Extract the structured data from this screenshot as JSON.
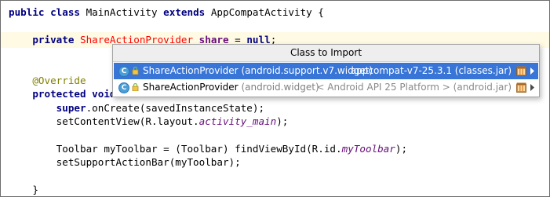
{
  "editor": {
    "lines": [
      {
        "parts": [
          {
            "t": "public class ",
            "c": "kw"
          },
          {
            "t": "MainActivity ",
            "c": ""
          },
          {
            "t": "extends ",
            "c": "kw"
          },
          {
            "t": "AppCompatActivity {",
            "c": ""
          }
        ]
      },
      {
        "parts": []
      },
      {
        "parts": [
          {
            "t": "    ",
            "c": ""
          },
          {
            "t": "private ",
            "c": "kw"
          },
          {
            "t": "ShareActionProvider",
            "c": "cls-err"
          },
          {
            "t": " ",
            "c": ""
          },
          {
            "t": "share",
            "c": "field"
          },
          {
            "t": " = ",
            "c": ""
          },
          {
            "t": "null",
            "c": "kw"
          },
          {
            "t": ";",
            "c": ""
          }
        ],
        "highlight": true
      },
      {
        "parts": []
      },
      {
        "parts": []
      },
      {
        "parts": [
          {
            "t": "    ",
            "c": ""
          },
          {
            "t": "@Override",
            "c": "ann"
          }
        ]
      },
      {
        "parts": [
          {
            "t": "    ",
            "c": ""
          },
          {
            "t": "protected void ",
            "c": "kw"
          },
          {
            "t": "o",
            "c": ""
          }
        ]
      },
      {
        "parts": [
          {
            "t": "        ",
            "c": ""
          },
          {
            "t": "super",
            "c": "kw"
          },
          {
            "t": ".onCreate(savedInstanceState);",
            "c": ""
          }
        ]
      },
      {
        "parts": [
          {
            "t": "        setContentView(R.layout.",
            "c": ""
          },
          {
            "t": "activity_main",
            "c": "field-it"
          },
          {
            "t": ");",
            "c": ""
          }
        ]
      },
      {
        "parts": []
      },
      {
        "parts": [
          {
            "t": "        Toolbar myToolbar = (Toolbar) findViewById(R.id.",
            "c": ""
          },
          {
            "t": "myToolbar",
            "c": "field-it"
          },
          {
            "t": ");",
            "c": ""
          }
        ]
      },
      {
        "parts": [
          {
            "t": "        setSupportActionBar(myToolbar);",
            "c": ""
          }
        ]
      },
      {
        "parts": []
      },
      {
        "parts": [
          {
            "t": "    }",
            "c": ""
          }
        ]
      }
    ]
  },
  "popup": {
    "title": "Class to Import",
    "items": [
      {
        "class_name": "ShareActionProvider",
        "package": "(android.support.v7.widget)",
        "library": "appcompat-v7-25.3.1 (classes.jar)",
        "icon": "class-icon",
        "selected": true
      },
      {
        "class_name": "ShareActionProvider",
        "package": "(android.widget)",
        "library": "< Android API 25 Platform > (android.jar)",
        "icon": "class-icon",
        "selected": false
      }
    ]
  },
  "colors": {
    "selection": "#3875d7",
    "current_line": "#fffae3",
    "keyword": "#000080",
    "unresolved": "#ff0000",
    "field": "#660e7a",
    "annotation": "#808000"
  }
}
